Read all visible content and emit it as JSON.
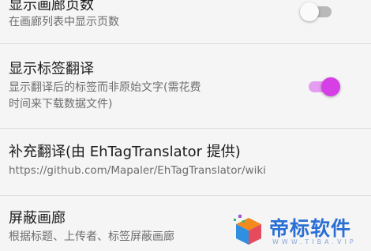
{
  "preferences": [
    {
      "title": "显示画廊页数",
      "summary_lines": [
        "在画廊列表中显示页数"
      ],
      "switch": "off"
    },
    {
      "title": "显示标签翻译",
      "summary_lines": [
        "显示翻译后的标签而非原始文字(需花费",
        "时间来下载数据文件)"
      ],
      "switch": "on"
    },
    {
      "title": "补充翻译(由 EhTagTranslator 提供)",
      "summary_lines": [
        "https://github.com/Mapaler/EhTagTranslator/wiki"
      ]
    },
    {
      "title": "屏蔽画廊",
      "summary_lines": [
        "根据标题、上传者、标签屏蔽画廊"
      ]
    }
  ],
  "colors": {
    "accent": "#d63fe6",
    "accent_track": "#e49df0",
    "switch_off_track": "#b9b9b9",
    "background": "#f5f5f5",
    "divider": "#dadada"
  },
  "watermark": {
    "text": "帝标软件",
    "subtext": "WWW.TIBA.VIP"
  }
}
